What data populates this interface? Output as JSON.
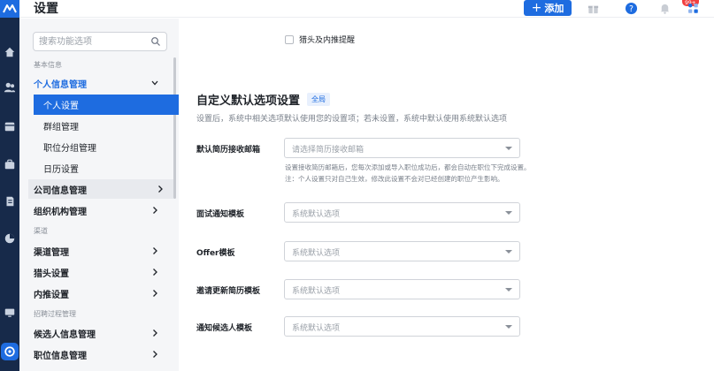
{
  "header": {
    "title": "设置",
    "add_label": "添加",
    "notification_badge": "99+"
  },
  "sidebar": {
    "search_placeholder": "搜索功能选项",
    "groups": [
      {
        "label": "基本信息"
      },
      {
        "label": "渠道"
      },
      {
        "label": "招聘过程管理"
      }
    ],
    "items": {
      "personal_info": "个人信息管理",
      "personal_settings": "个人设置",
      "group_mgmt": "群组管理",
      "position_groups": "职位分组管理",
      "calendar": "日历设置",
      "company_info": "公司信息管理",
      "org_mgmt": "组织机构管理",
      "channel_mgmt": "渠道管理",
      "headhunter": "猎头设置",
      "referral": "内推设置",
      "candidate_info": "候选人信息管理",
      "position_info": "职位信息管理"
    }
  },
  "main": {
    "checkbox_label": "猎头及内推提醒",
    "section_title": "自定义默认选项设置",
    "section_tag": "全局",
    "section_desc": "设置后，系统中相关选项默认使用您的设置项；若未设置，系统中默认使用系统默认选项",
    "fields": {
      "resume_email": {
        "label": "默认简历接收邮箱",
        "placeholder": "请选择简历接收邮箱"
      },
      "interview_tpl": {
        "label": "面试通知模板",
        "placeholder": "系统默认选项"
      },
      "offer_tpl": {
        "label": "Offer模板",
        "placeholder": "系统默认选项"
      },
      "update_resume_tpl": {
        "label": "邀请更新简历模板",
        "placeholder": "系统默认选项"
      },
      "notify_candidate_tpl": {
        "label": "通知候选人模板",
        "placeholder": "系统默认选项"
      }
    },
    "hint_line1": "设置接收简历邮箱后，您每次添加或导入职位成功后，都会自动在职位下完成设置。",
    "hint_line2": "注：个人设置只对自己生效，修改此设置不会对已经创建的职位产生影响。"
  },
  "colors": {
    "accent": "#1e6ce0",
    "rail": "#172a4a",
    "badge": "#f23f3f"
  }
}
